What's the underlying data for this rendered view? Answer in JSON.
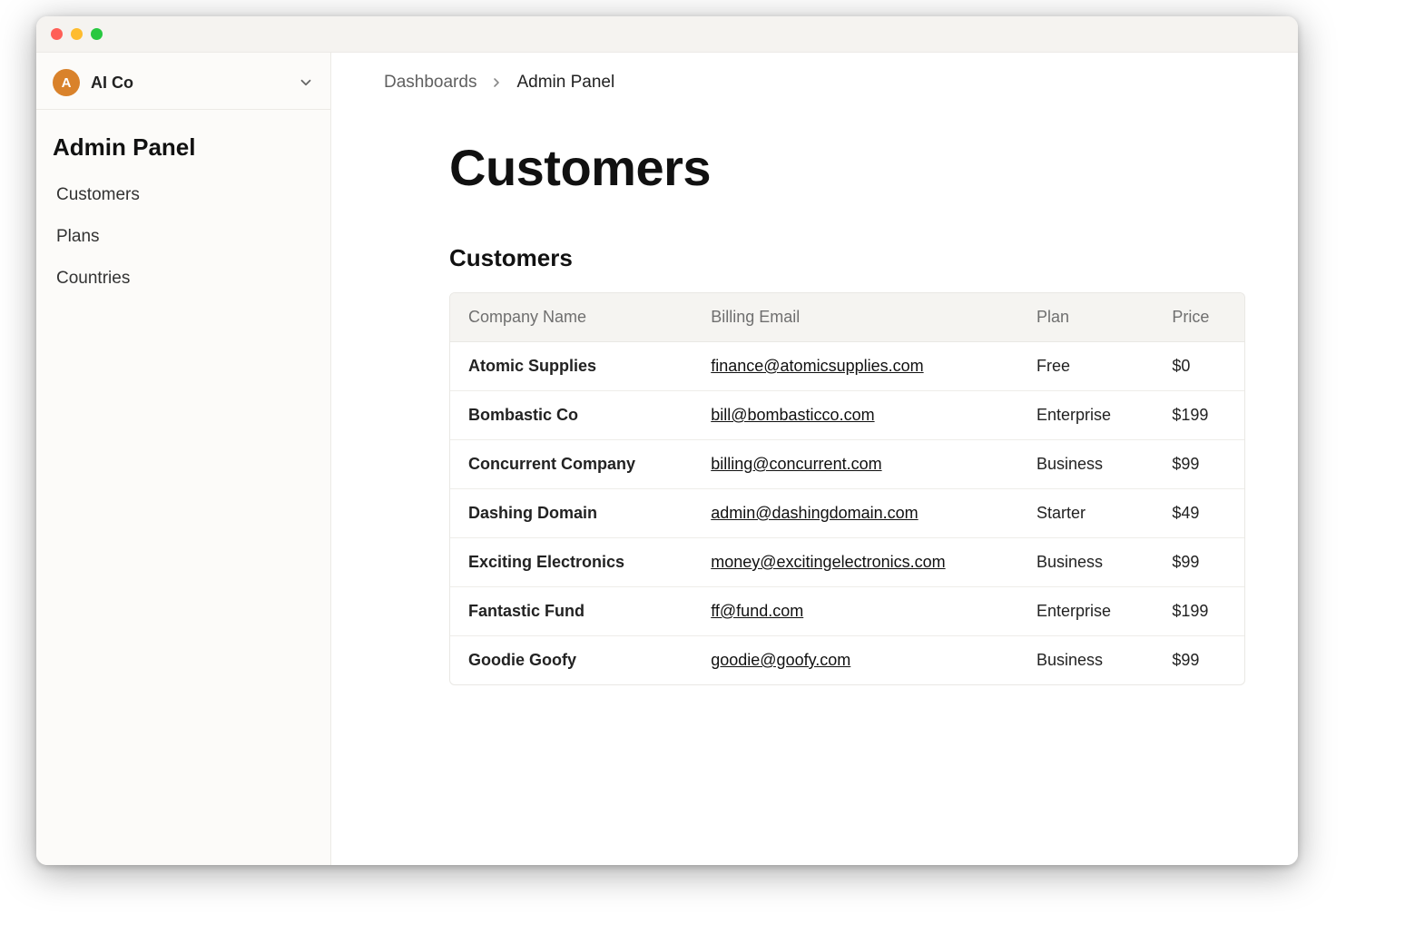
{
  "workspace": {
    "avatar_letter": "A",
    "name": "AI Co"
  },
  "sidebar": {
    "title": "Admin Panel",
    "items": [
      {
        "label": "Customers"
      },
      {
        "label": "Plans"
      },
      {
        "label": "Countries"
      }
    ]
  },
  "breadcrumb": {
    "root": "Dashboards",
    "current": "Admin Panel"
  },
  "page": {
    "title": "Customers",
    "section_title": "Customers"
  },
  "table": {
    "columns": [
      "Company Name",
      "Billing Email",
      "Plan",
      "Price"
    ],
    "rows": [
      {
        "company": "Atomic Supplies",
        "email": "finance@atomicsupplies.com",
        "plan": "Free",
        "price": "$0"
      },
      {
        "company": "Bombastic Co",
        "email": "bill@bombasticco.com",
        "plan": "Enterprise",
        "price": "$199"
      },
      {
        "company": "Concurrent Company",
        "email": "billing@concurrent.com",
        "plan": "Business",
        "price": "$99"
      },
      {
        "company": "Dashing Domain",
        "email": "admin@dashingdomain.com",
        "plan": "Starter",
        "price": "$49"
      },
      {
        "company": "Exciting Electronics",
        "email": "money@excitingelectronics.com",
        "plan": "Business",
        "price": "$99"
      },
      {
        "company": "Fantastic Fund",
        "email": "ff@fund.com",
        "plan": "Enterprise",
        "price": "$199"
      },
      {
        "company": "Goodie Goofy",
        "email": "goodie@goofy.com",
        "plan": "Business",
        "price": "$99"
      }
    ]
  }
}
